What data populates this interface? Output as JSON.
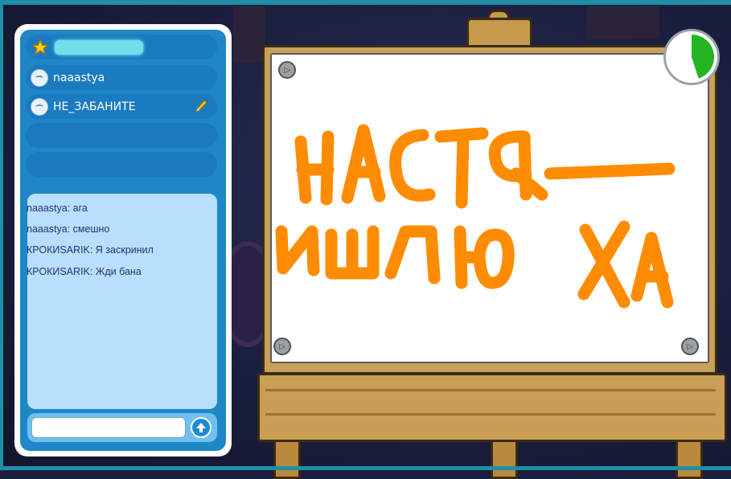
{
  "players": [
    {
      "name": "",
      "icon": "star-icon",
      "redacted": true
    },
    {
      "name": "naaastya",
      "icon": "penguin-avatar-icon"
    },
    {
      "name": "НЕ_ЗАБАНИТЕ",
      "icon": "penguin-avatar-icon",
      "drawing": true
    },
    {
      "name": "",
      "empty": true
    },
    {
      "name": "",
      "empty": true
    }
  ],
  "chat": {
    "messages": [
      "naaastya: ага",
      "naaastya: смешно",
      "КРОКИSARIK: Я заскринил",
      "КРОКИSARIK: Жди бана"
    ],
    "input_value": "",
    "send_icon": "arrow-up-icon"
  },
  "timer": {
    "remaining_fraction": 0.45,
    "color": "#22b422"
  },
  "canvas": {
    "ink_color": "#ff8c00",
    "background": "#ffffff"
  },
  "colors": {
    "panel_blue": "#1f87c8",
    "chat_bg": "#b6e0fb",
    "wood": "#c99f55"
  }
}
